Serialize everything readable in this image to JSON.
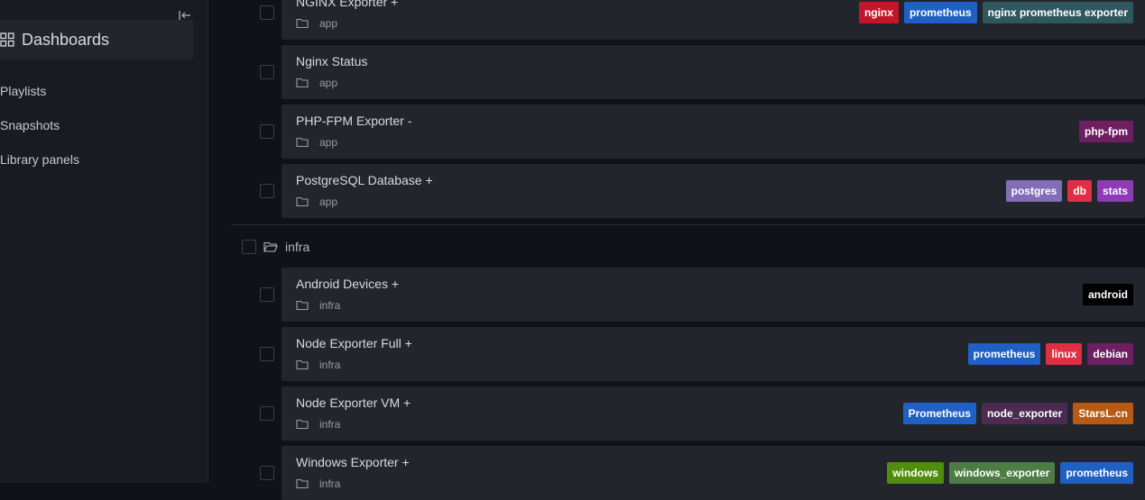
{
  "sidebar": {
    "active_item": "Dashboards",
    "items": [
      {
        "label": "Playlists"
      },
      {
        "label": "Snapshots"
      },
      {
        "label": "Library panels"
      }
    ]
  },
  "dashboards": [
    {
      "title": "NGINX Exporter +",
      "folder": "app",
      "tags": [
        {
          "label": "nginx",
          "color": "#c4162a"
        },
        {
          "label": "prometheus",
          "color": "#1f60c4"
        },
        {
          "label": "nginx prometheus exporter",
          "color": "#2f575e"
        }
      ]
    },
    {
      "title": "Nginx Status",
      "folder": "app",
      "tags": []
    },
    {
      "title": "PHP-FPM Exporter -",
      "folder": "app",
      "tags": [
        {
          "label": "php-fpm",
          "color": "#6d1f62"
        }
      ]
    },
    {
      "title": "PostgreSQL Database +",
      "folder": "app",
      "tags": [
        {
          "label": "postgres",
          "color": "#806eb7"
        },
        {
          "label": "db",
          "color": "#e02f44"
        },
        {
          "label": "stats",
          "color": "#8f3bb8"
        }
      ]
    }
  ],
  "folder_group": {
    "label": "infra"
  },
  "infra_dashboards": [
    {
      "title": "Android Devices +",
      "folder": "infra",
      "tags": [
        {
          "label": "android",
          "color": "#000000"
        }
      ]
    },
    {
      "title": "Node Exporter Full +",
      "folder": "infra",
      "tags": [
        {
          "label": "prometheus",
          "color": "#1f60c4"
        },
        {
          "label": "linux",
          "color": "#e02f44"
        },
        {
          "label": "debian",
          "color": "#6d1f62"
        }
      ]
    },
    {
      "title": "Node Exporter VM +",
      "folder": "infra",
      "tags": [
        {
          "label": "Prometheus",
          "color": "#1f60c4"
        },
        {
          "label": "node_exporter",
          "color": "#4b2c50"
        },
        {
          "label": "StarsL.cn",
          "color": "#b85a11"
        }
      ]
    },
    {
      "title": "Windows Exporter +",
      "folder": "infra",
      "tags": [
        {
          "label": "windows",
          "color": "#508d0d"
        },
        {
          "label": "windows_exporter",
          "color": "#4d7d45"
        },
        {
          "label": "prometheus",
          "color": "#1f60c4"
        }
      ]
    }
  ]
}
